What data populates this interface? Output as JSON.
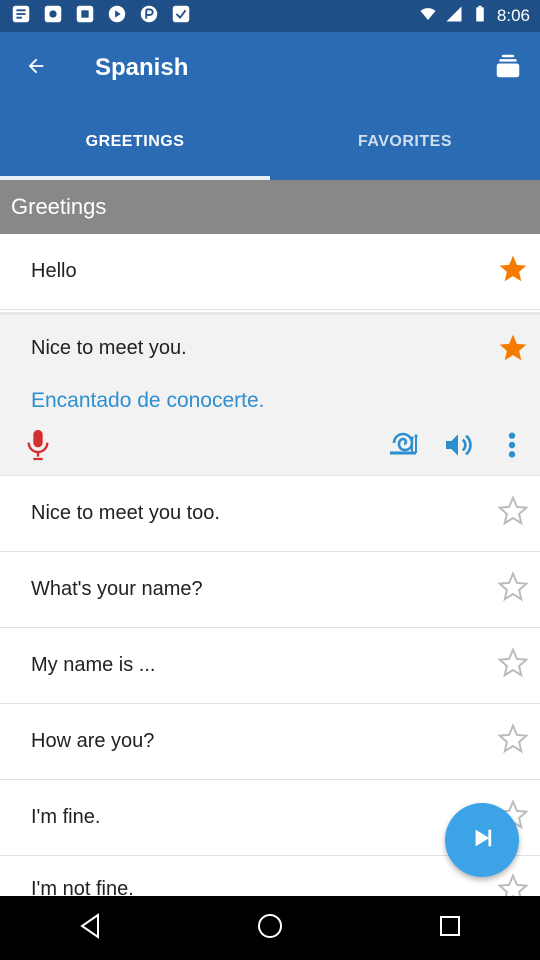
{
  "status_bar": {
    "time": "8:06"
  },
  "app_bar": {
    "title": "Spanish"
  },
  "tabs": [
    {
      "label": "GREETINGS",
      "active": true
    },
    {
      "label": "FAVORITES",
      "active": false
    }
  ],
  "section": {
    "title": "Greetings"
  },
  "phrases": [
    {
      "text": "Hello",
      "favorite": true
    },
    {
      "text": "Nice to meet you.",
      "favorite": true,
      "expanded": true,
      "translation": "Encantado de conocerte."
    },
    {
      "text": "Nice to meet you too.",
      "favorite": false
    },
    {
      "text": "What's your name?",
      "favorite": false
    },
    {
      "text": "My name is ...",
      "favorite": false
    },
    {
      "text": "How are you?",
      "favorite": false
    },
    {
      "text": "I'm fine.",
      "favorite": false
    },
    {
      "text": "I'm not fine.",
      "favorite": false
    }
  ],
  "colors": {
    "status_bar": "#1e4f86",
    "app_bar": "#2a6bb3",
    "section_header": "#888888",
    "star_active": "#f57c00",
    "star_inactive": "#bbbbbb",
    "translation": "#2e8fd0",
    "mic": "#d32f2f",
    "fab": "#3ba3e6"
  },
  "icons": {
    "back": "arrow-left-icon",
    "cards": "cards-icon",
    "mic": "microphone-icon",
    "snail": "snail-icon",
    "volume": "volume-icon",
    "more": "more-vertical-icon",
    "play": "play-icon"
  }
}
